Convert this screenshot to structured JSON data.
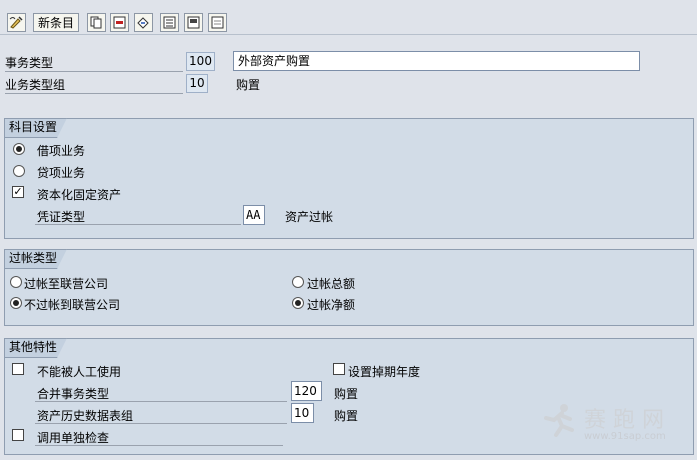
{
  "toolbar": {
    "new_entries_label": "新条目",
    "icons": [
      "edit-toggle-icon",
      "copy-icon",
      "delete-icon",
      "undo-icon",
      "select-all-icon",
      "select-block-icon",
      "deselect-icon"
    ]
  },
  "header": {
    "transaction_type_label": "事务类型",
    "transaction_type_value": "100",
    "transaction_type_text": "外部资产购置",
    "transaction_group_label": "业务类型组",
    "transaction_group_value": "10",
    "transaction_group_text": "购置"
  },
  "account_settings": {
    "title": "科目设置",
    "debit_label": "借项业务",
    "debit_selected": true,
    "credit_label": "贷项业务",
    "credit_selected": false,
    "capitalize_label": "资本化固定资产",
    "capitalize_checked": true,
    "doc_type_label": "凭证类型",
    "doc_type_value": "AA",
    "doc_type_text": "资产过帐"
  },
  "posting_type": {
    "title": "过帐类型",
    "options": [
      {
        "label": "过帐至联营公司",
        "selected": false
      },
      {
        "label": "不过帐到联营公司",
        "selected": true
      },
      {
        "label": "过帐总额",
        "selected": false
      },
      {
        "label": "过帐净额",
        "selected": true
      }
    ]
  },
  "other_features": {
    "title": "其他特性",
    "no_manual_label": "不能被人工使用",
    "no_manual_checked": false,
    "set_retirement_year_label": "设置掉期年度",
    "set_retirement_year_checked": false,
    "consolidation_type_label": "合并事务类型",
    "consolidation_type_value": "120",
    "consolidation_type_text": "购置",
    "history_group_label": "资产历史数据表组",
    "history_group_value": "10",
    "history_group_text": "购置",
    "call_check_label": "调用单独检查",
    "call_check_checked": false
  },
  "watermark": {
    "brand": "赛 跑 网",
    "url": "www.91sap.com"
  },
  "colors": {
    "background": "#dfe3ea",
    "group_fill": "#d2dce7",
    "group_title": "#c3d0df",
    "watermark": "#cfd3d8"
  }
}
